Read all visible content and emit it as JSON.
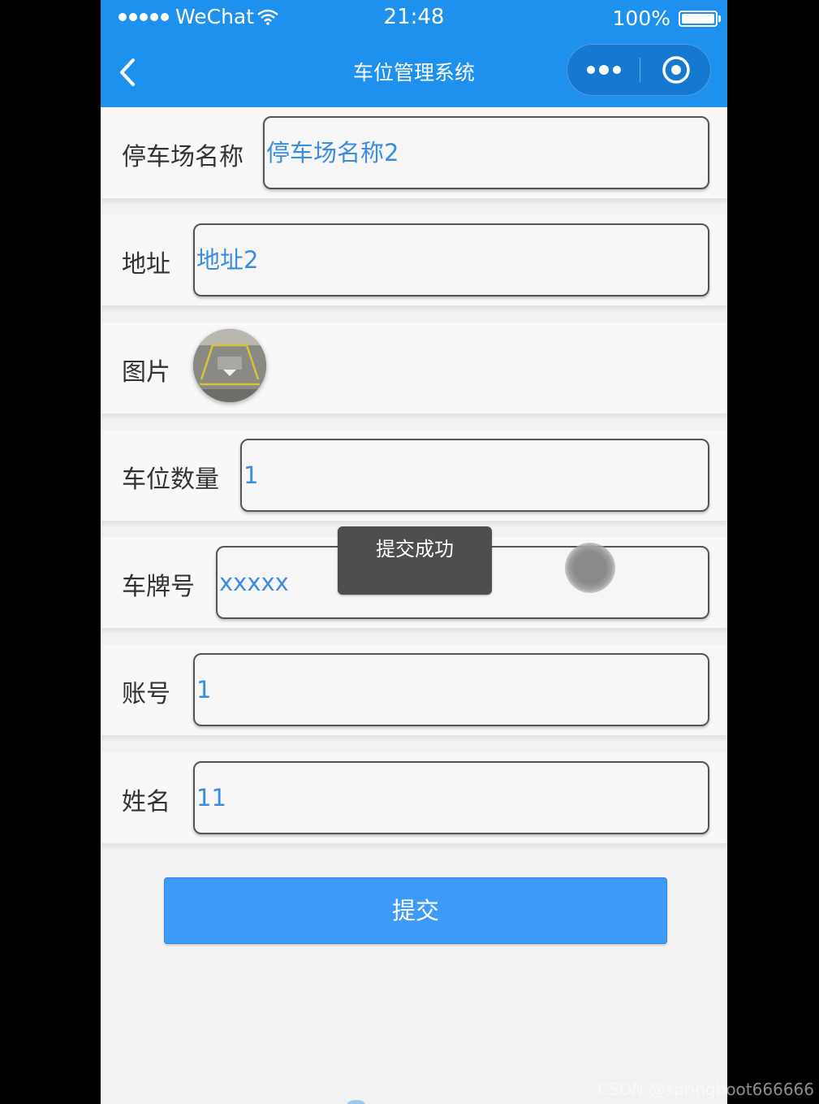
{
  "status_bar": {
    "carrier": "WeChat",
    "time": "21:48",
    "battery": "100%"
  },
  "nav_bar": {
    "title": "车位管理系统"
  },
  "form": {
    "fields": [
      {
        "label": "停车场名称",
        "value": "停车场名称2"
      },
      {
        "label": "地址",
        "value": "地址2"
      },
      {
        "label": "图片"
      },
      {
        "label": "车位数量",
        "value": "1"
      },
      {
        "label": "车牌号",
        "value": "xxxxx"
      },
      {
        "label": "账号",
        "value": "1"
      },
      {
        "label": "姓名",
        "value": "11"
      }
    ],
    "submit_label": "提交"
  },
  "toast": {
    "message": "提交成功"
  },
  "watermark": "CSDN @springboot666666",
  "colors": {
    "primary": "#1e90ee",
    "button": "#3d9bf7",
    "input_text": "#3a8ee0",
    "toast_bg": "#4e4e4e"
  }
}
